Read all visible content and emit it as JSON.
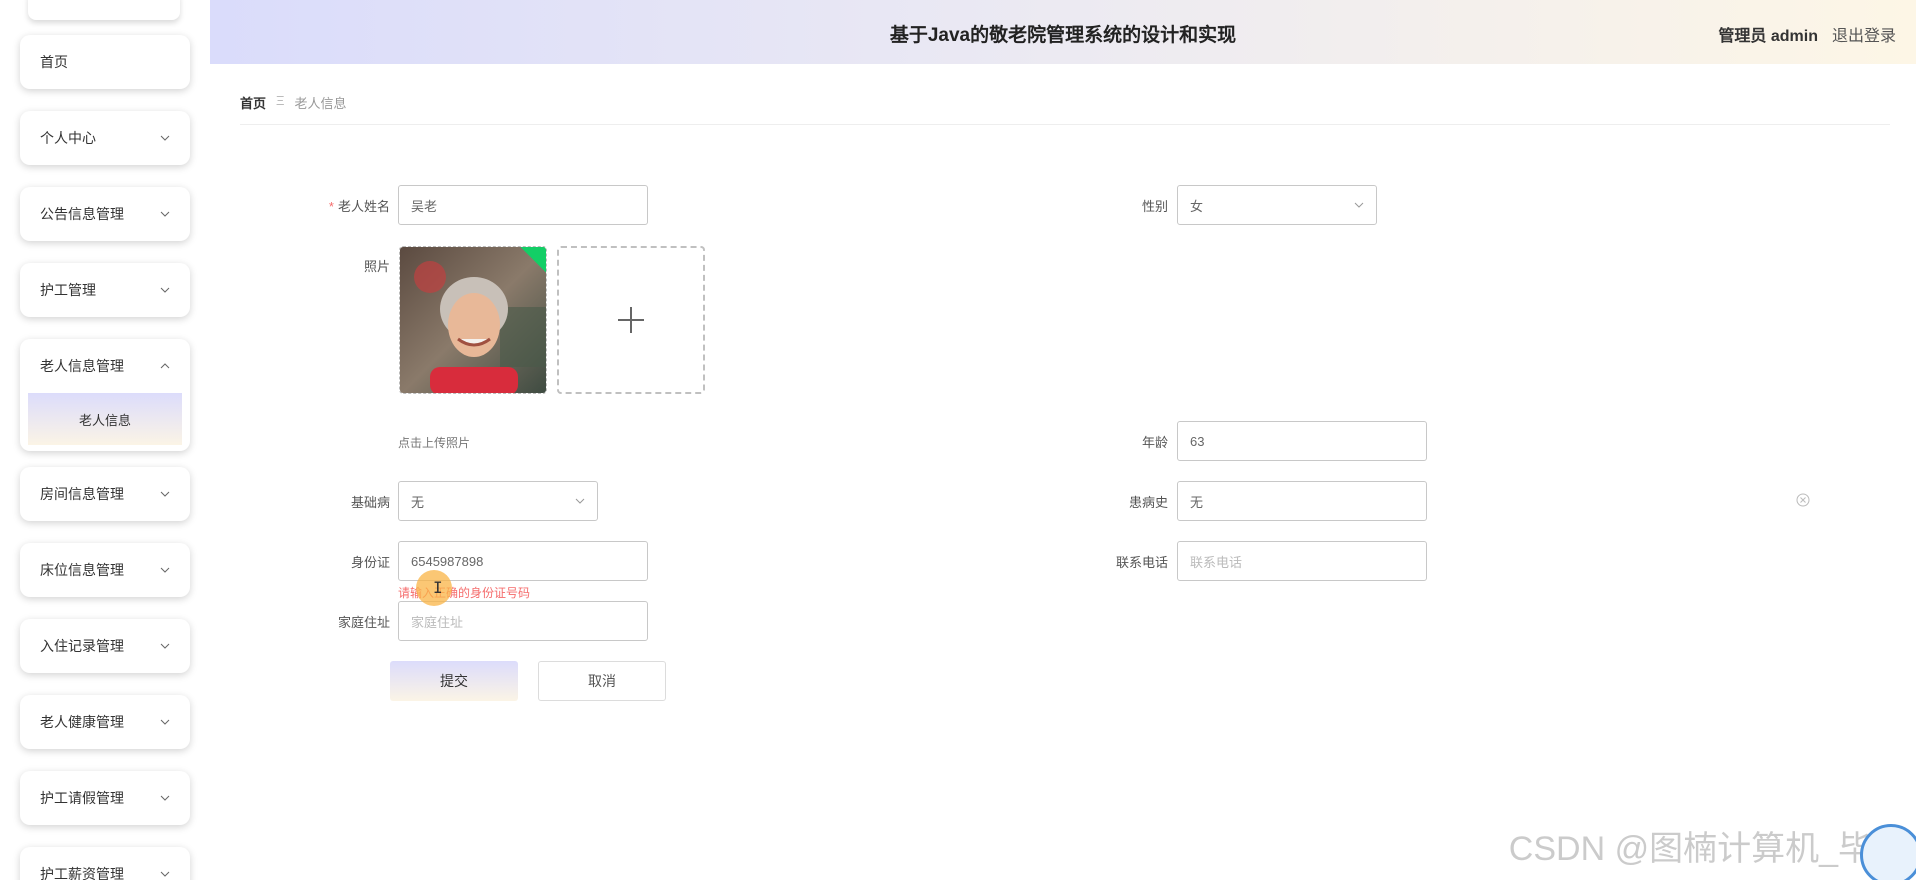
{
  "header": {
    "title": "基于Java的敬老院管理系统的设计和实现",
    "user": "管理员 admin",
    "logout": "退出登录"
  },
  "sidebar": {
    "items": [
      {
        "label": "首页"
      },
      {
        "label": "个人中心"
      },
      {
        "label": "公告信息管理"
      },
      {
        "label": "护工管理"
      },
      {
        "label": "老人信息管理",
        "expanded": true,
        "children": [
          {
            "label": "老人信息"
          }
        ]
      },
      {
        "label": "房间信息管理"
      },
      {
        "label": "床位信息管理"
      },
      {
        "label": "入住记录管理"
      },
      {
        "label": "老人健康管理"
      },
      {
        "label": "护工请假管理"
      },
      {
        "label": "护工薪资管理"
      }
    ]
  },
  "breadcrumb": {
    "home": "首页",
    "separator": "Ξ",
    "current": "老人信息"
  },
  "form": {
    "name": {
      "label": "老人姓名",
      "value": "吴老",
      "required_mark": "*"
    },
    "gender": {
      "label": "性别",
      "value": "女"
    },
    "photo": {
      "label": "照片",
      "hint": "点击上传照片"
    },
    "age": {
      "label": "年龄",
      "value": "63"
    },
    "disease": {
      "label": "基础病",
      "value": "无"
    },
    "history": {
      "label": "患病史",
      "value": "无"
    },
    "id_card": {
      "label": "身份证",
      "value": "6545987898",
      "error": "请输入正确的身份证号码"
    },
    "phone": {
      "label": "联系电话",
      "placeholder": "联系电话"
    },
    "address": {
      "label": "家庭住址",
      "placeholder": "家庭住址"
    }
  },
  "buttons": {
    "submit": "提交",
    "cancel": "取消"
  },
  "watermark": "CSDN @图楠计算机_毕设",
  "colors": {
    "accent_gradient_start": "#dcdcfb",
    "accent_gradient_end": "#fbf4e6",
    "error": "#f56c6c",
    "upload_success": "#13ce66"
  }
}
